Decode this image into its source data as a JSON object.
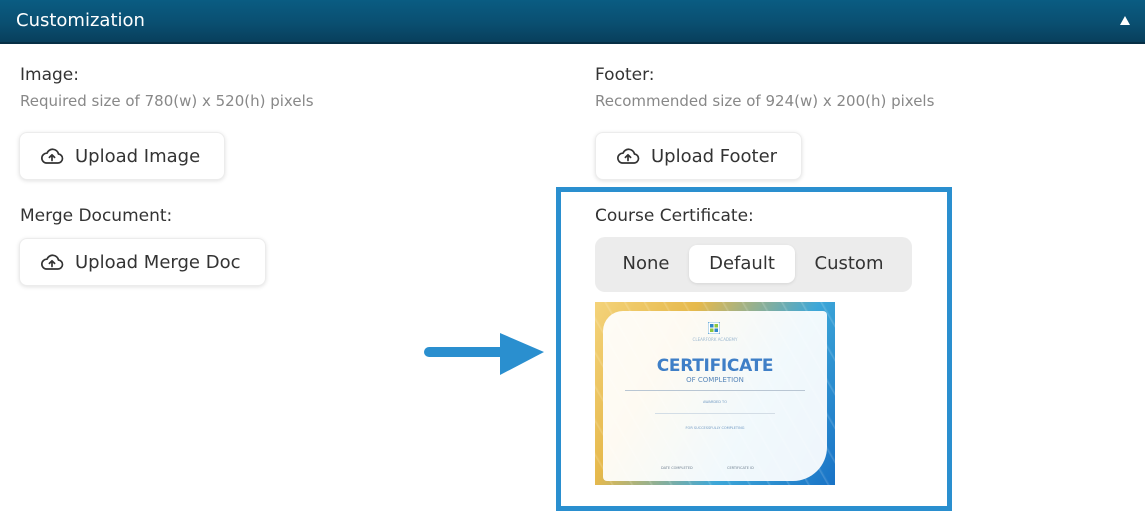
{
  "header": {
    "title": "Customization"
  },
  "image_section": {
    "label": "Image:",
    "hint": "Required size of 780(w) x 520(h) pixels",
    "button_label": "Upload Image"
  },
  "merge_section": {
    "label": "Merge Document:",
    "button_label": "Upload Merge Doc"
  },
  "footer_section": {
    "label": "Footer:",
    "hint": "Recommended size of 924(w) x 200(h) pixels",
    "button_label": "Upload Footer"
  },
  "certificate_section": {
    "label": "Course Certificate:",
    "options": [
      "None",
      "Default",
      "Custom"
    ],
    "selected": "Default",
    "preview": {
      "title": "CERTIFICATE",
      "subtitle": "OF COMPLETION",
      "logo_text": "CLEARFORK ACADEMY",
      "awarded_to": "AWARDED TO",
      "for_text": "FOR SUCCESSFULLY COMPLETING",
      "date_label": "DATE COMPLETED",
      "cert_id_label": "CERTIFICATE ID"
    }
  },
  "colors": {
    "header_bg": "#0a4f71",
    "highlight": "#2a8fcf",
    "arrow": "#2a8fcf"
  },
  "icons": {
    "upload": "cloud-upload-icon",
    "collapse": "triangle-up-icon",
    "annotation": "arrow-right-icon"
  }
}
